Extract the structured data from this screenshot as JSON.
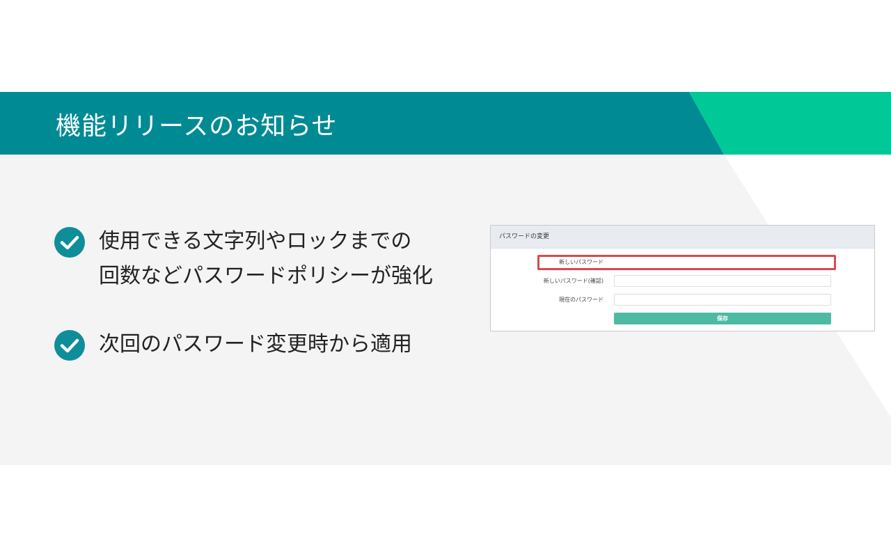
{
  "slide": {
    "title": "機能リリースのお知らせ"
  },
  "bullets": [
    {
      "icon": "checkmark-circle-icon",
      "lines": [
        "使用できる文字列やロックまでの",
        "回数などパスワードポリシーが強化"
      ]
    },
    {
      "icon": "checkmark-circle-icon",
      "lines": [
        "次回のパスワード変更時から適用"
      ]
    }
  ],
  "screenshot": {
    "panel_title": "パスワードの変更",
    "fields": [
      {
        "label": "新しいパスワード",
        "value": "",
        "highlighted": true
      },
      {
        "label": "新しいパスワード(確認)",
        "value": ""
      },
      {
        "label": "現在のパスワード",
        "value": ""
      }
    ],
    "save_label": "保存"
  },
  "colors": {
    "header_teal": "#008b94",
    "accent_green": "#00c997",
    "check_teal": "#0f8e99",
    "highlight_red": "#d9484f",
    "save_button": "#4dbba4"
  }
}
